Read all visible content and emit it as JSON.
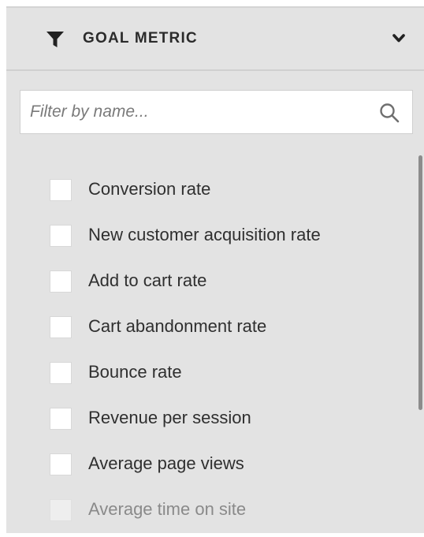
{
  "header": {
    "title": "GOAL METRIC",
    "filter_icon": "funnel-icon",
    "toggle_icon": "chevron-down-icon"
  },
  "search": {
    "placeholder": "Filter by name...",
    "value": "",
    "icon": "search-icon"
  },
  "metrics": [
    {
      "label": "Conversion rate",
      "checked": false
    },
    {
      "label": "New customer acquisition rate",
      "checked": false
    },
    {
      "label": "Add to cart rate",
      "checked": false
    },
    {
      "label": "Cart abandonment rate",
      "checked": false
    },
    {
      "label": "Bounce rate",
      "checked": false
    },
    {
      "label": "Revenue per session",
      "checked": false
    },
    {
      "label": "Average page views",
      "checked": false
    },
    {
      "label": "Average time on site",
      "checked": false
    }
  ],
  "colors": {
    "panel_bg": "#e3e3e3",
    "text": "#2f2f2f",
    "scrollbar": "#8c8c8c"
  }
}
